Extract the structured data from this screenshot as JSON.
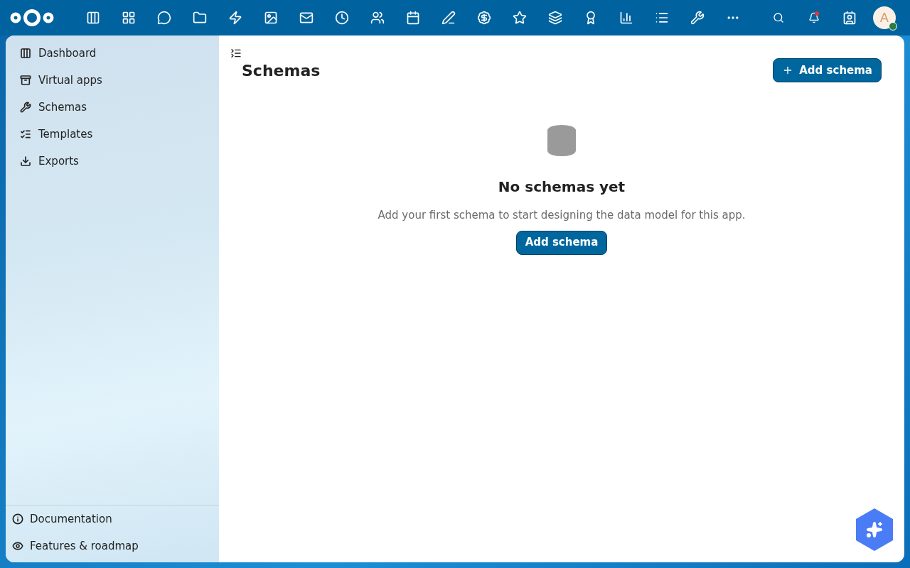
{
  "header": {
    "avatar": "A",
    "notification": true
  },
  "sidebar": {
    "items": [
      {
        "label": "Dashboard"
      },
      {
        "label": "Virtual apps"
      },
      {
        "label": "Schemas"
      },
      {
        "label": "Templates"
      },
      {
        "label": "Exports"
      }
    ],
    "footer": [
      {
        "label": "Documentation"
      },
      {
        "label": "Features & roadmap"
      }
    ]
  },
  "page": {
    "title": "Schemas",
    "add_button": "Add schema"
  },
  "empty_state": {
    "title": "No schemas yet",
    "text": "Add your first schema to start designing the data model for this app.",
    "button": "Add schema"
  }
}
